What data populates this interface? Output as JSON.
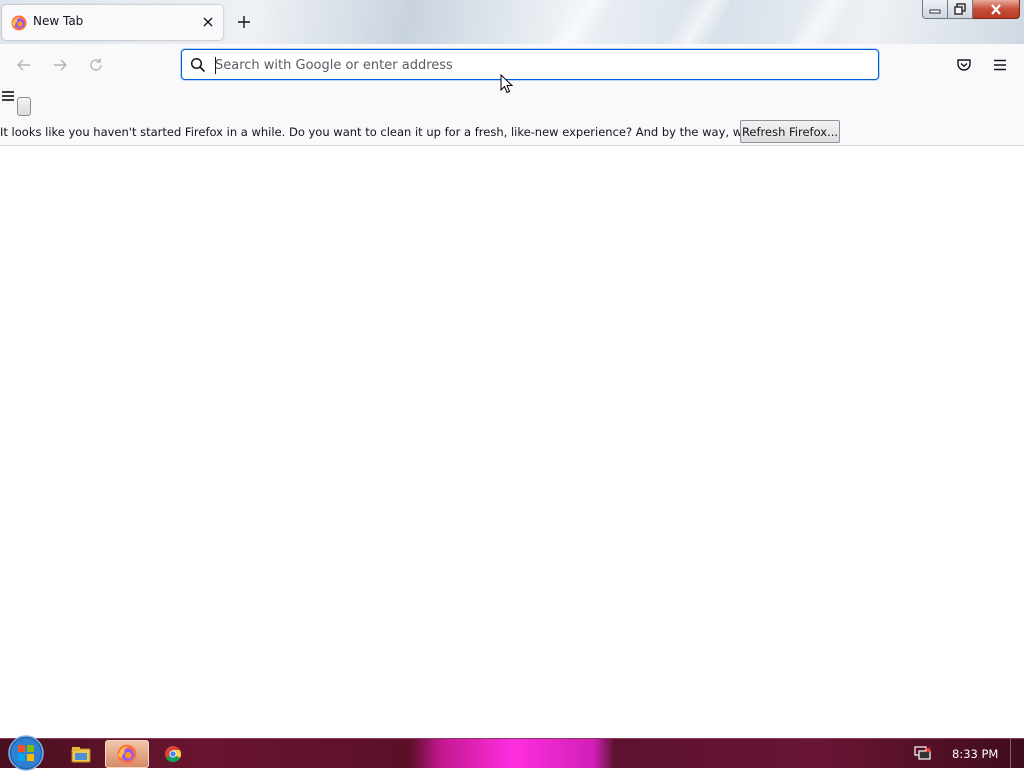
{
  "browser": {
    "tab": {
      "title": "New Tab",
      "favicon": "firefox-icon",
      "close_icon": "close-icon"
    },
    "new_tab_icon": "plus-icon",
    "window_controls": [
      "minimize-icon",
      "restore-icon",
      "close-icon"
    ]
  },
  "navbar": {
    "back_icon": "back-arrow-icon",
    "forward_icon": "forward-arrow-icon",
    "reload_icon": "reload-icon",
    "search_icon": "search-icon",
    "url_placeholder": "Search with Google or enter address",
    "url_value": "",
    "pocket_icon": "pocket-icon",
    "menu_icon": "hamburger-menu-icon"
  },
  "notification": {
    "message": "It looks like you haven't started Firefox in a while. Do you want to clean it up for a fresh, like-new experience? And by the way, welcome back!",
    "button_label": "Refresh Firefox..."
  },
  "taskbar": {
    "start_icon": "windows-start-icon",
    "apps": [
      {
        "name": "file-explorer-icon",
        "active": false
      },
      {
        "name": "firefox-icon",
        "active": true
      },
      {
        "name": "chrome-icon",
        "active": false
      }
    ],
    "tray_icon": "network-icon",
    "clock": "8:33 PM"
  },
  "colors": {
    "accent": "#0061e0",
    "toolbar_bg": "#f9f9fb",
    "taskbar_highlight": "#ff2ee0"
  }
}
